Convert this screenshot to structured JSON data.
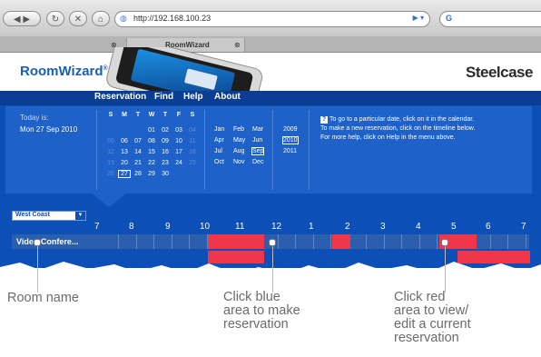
{
  "browser": {
    "url": "http://192.168.100.23",
    "tab_active": "RoomWizard",
    "tab_close": "⊗",
    "search_glyph": "G",
    "go_glyph": "▶ ▾"
  },
  "page": {
    "logo": "RoomWizard",
    "logo_mark": "®",
    "brand": "Steelcase",
    "nav": [
      "Reservation",
      "Find",
      "Help",
      "About"
    ]
  },
  "info": {
    "today_label": "Today is:",
    "today_value": "Mon 27 Sep 2010",
    "weekday_headers": [
      "S",
      "M",
      "T",
      "W",
      "T",
      "F",
      "S"
    ],
    "calendar_rows": [
      [
        "",
        "",
        "",
        "01",
        "02",
        "03",
        "04"
      ],
      [
        "05",
        "06",
        "07",
        "08",
        "09",
        "10",
        "11"
      ],
      [
        "12",
        "13",
        "14",
        "15",
        "16",
        "17",
        "18"
      ],
      [
        "19",
        "20",
        "21",
        "22",
        "23",
        "24",
        "25"
      ],
      [
        "26",
        "27",
        "28",
        "29",
        "30",
        "",
        ""
      ]
    ],
    "selected_day": "27",
    "months": [
      [
        "Jan",
        "Feb",
        "Mar"
      ],
      [
        "Apr",
        "May",
        "Jun"
      ],
      [
        "Jul",
        "Aug",
        "Sep"
      ],
      [
        "Oct",
        "Nov",
        "Dec"
      ]
    ],
    "selected_month": "Sep",
    "years": [
      "2009",
      "2010",
      "2011"
    ],
    "selected_year": "2010",
    "help_lines": [
      "To go to a particular date, click on it in the calendar.",
      "To make a new reservation, click on the timeline below.",
      "For more help, click on Help in the menu above."
    ]
  },
  "timeline": {
    "location": "West Coast",
    "hours": [
      "7",
      "8",
      "9",
      "10",
      "11",
      "12",
      "1",
      "2",
      "3",
      "4",
      "5",
      "6",
      "7"
    ],
    "room": "Video Confere..."
  },
  "callouts": {
    "room_name": "Room name",
    "blue_area": [
      "Click blue",
      "area to make",
      "reservation"
    ],
    "red_area": [
      "Click red",
      "area to view/",
      "edit a current",
      "reservation"
    ]
  },
  "colors": {
    "panel_blue": "#0b4fb7",
    "reserved_red": "#f0364b",
    "link_blue": "#1a5fb4"
  }
}
